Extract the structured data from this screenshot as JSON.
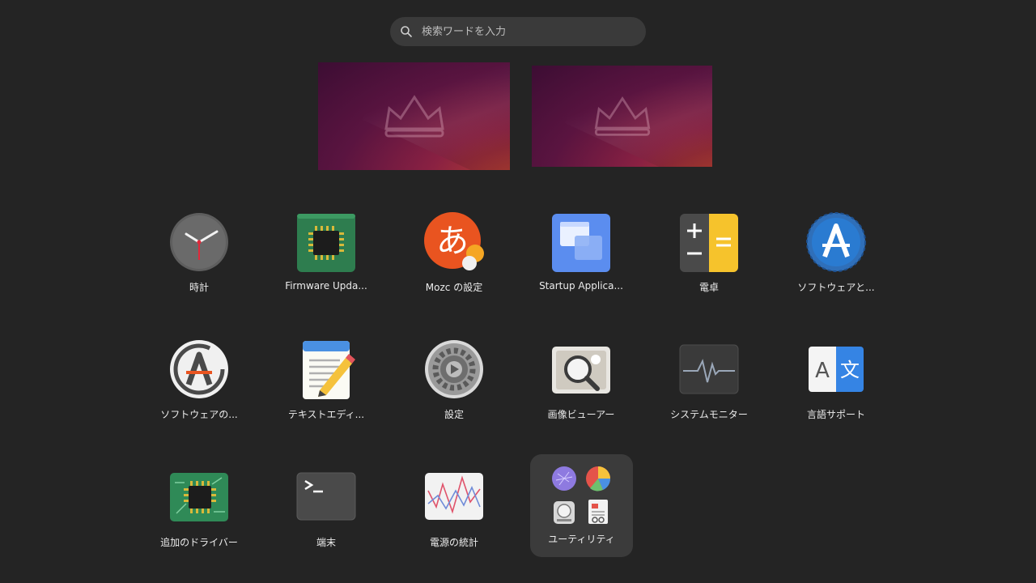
{
  "search": {
    "placeholder": "検索ワードを入力"
  },
  "apps": [
    {
      "label": "時計",
      "icon": "clock-icon"
    },
    {
      "label": "Firmware Upda...",
      "icon": "firmware-chip-icon"
    },
    {
      "label": "Mozc の設定",
      "icon": "mozc-icon"
    },
    {
      "label": "Startup Applica...",
      "icon": "startup-windows-icon"
    },
    {
      "label": "電卓",
      "icon": "calculator-icon"
    },
    {
      "label": "ソフトウェアと...",
      "icon": "software-sources-icon"
    },
    {
      "label": "ソフトウェアの...",
      "icon": "software-updater-icon"
    },
    {
      "label": "テキストエディ...",
      "icon": "text-editor-icon"
    },
    {
      "label": "設定",
      "icon": "settings-gear-icon"
    },
    {
      "label": "画像ビューアー",
      "icon": "image-viewer-icon"
    },
    {
      "label": "システムモニター",
      "icon": "system-monitor-icon"
    },
    {
      "label": "言語サポート",
      "icon": "language-support-icon"
    },
    {
      "label": "追加のドライバー",
      "icon": "driver-chip-icon"
    },
    {
      "label": "端末",
      "icon": "terminal-icon"
    },
    {
      "label": "電源の統計",
      "icon": "power-statistics-icon"
    }
  ],
  "folder": {
    "label": "ユーティリティ",
    "icon": "utilities-folder-icon"
  },
  "colors": {
    "background": "#242424",
    "search_bg": "#3a3a3a",
    "folder_bg": "#3b3b3b",
    "accent_orange": "#e95420"
  }
}
